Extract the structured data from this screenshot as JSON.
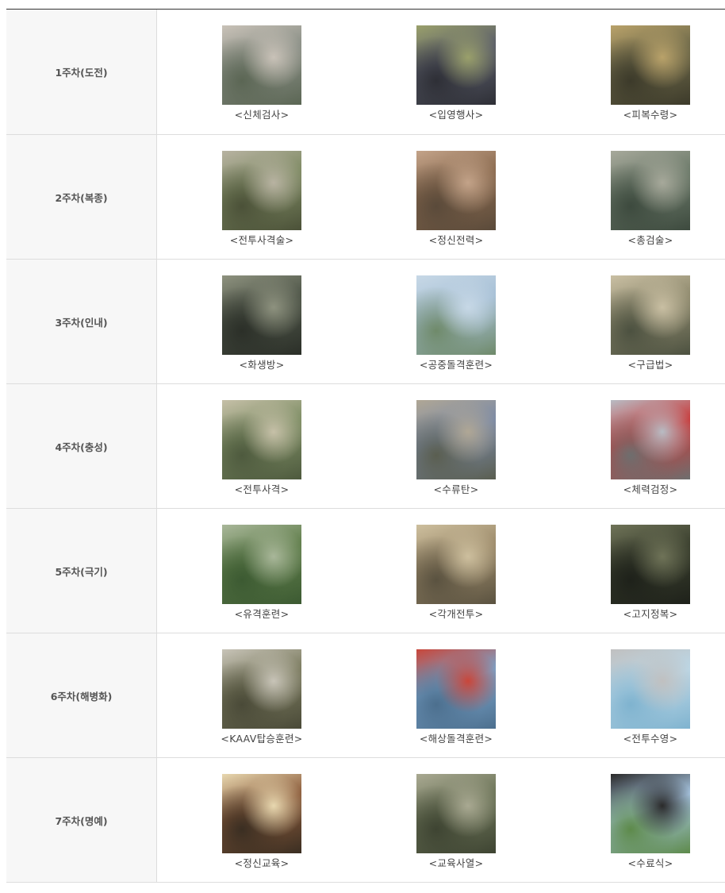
{
  "rows": [
    {
      "week": "1주차(도전)",
      "items": [
        {
          "caption": "<신체검사>",
          "photo": "soldier-medical-check-photo",
          "colors": [
            "#8a8f86",
            "#5b6654",
            "#c9c2b8"
          ]
        },
        {
          "caption": "<입영행사>",
          "photo": "enlistment-crowd-photo",
          "colors": [
            "#5a5d6a",
            "#2e2f36",
            "#9aa06b"
          ]
        },
        {
          "caption": "<피복수령>",
          "photo": "uniform-issue-photo",
          "colors": [
            "#6f6a4a",
            "#3c3a2a",
            "#b9a26a"
          ]
        }
      ]
    },
    {
      "week": "2주차(복종)",
      "items": [
        {
          "caption": "<전투사격술>",
          "photo": "rifle-marksmanship-photo",
          "colors": [
            "#7e8a63",
            "#4b5138",
            "#b8b3a2"
          ]
        },
        {
          "caption": "<정신전력>",
          "photo": "mental-strength-photo",
          "colors": [
            "#8a6a4f",
            "#5a4a3a",
            "#c3a389"
          ]
        },
        {
          "caption": "<총검술>",
          "photo": "bayonet-drill-photo",
          "colors": [
            "#6c7a6a",
            "#3d4a3e",
            "#a7a99b"
          ]
        }
      ]
    },
    {
      "week": "3주차(인내)",
      "items": [
        {
          "caption": "<화생방>",
          "photo": "gas-mask-training-photo",
          "colors": [
            "#4e5548",
            "#2b2f28",
            "#8e927f"
          ]
        },
        {
          "caption": "<공중돌격훈련>",
          "photo": "air-assault-training-photo",
          "colors": [
            "#a7c0d6",
            "#6f8a6a",
            "#c7d8e6"
          ]
        },
        {
          "caption": "<구급법>",
          "photo": "first-aid-training-photo",
          "colors": [
            "#8f8a6e",
            "#4c5140",
            "#c9bfa3"
          ]
        }
      ]
    },
    {
      "week": "4주차(충성)",
      "items": [
        {
          "caption": "<전투사격>",
          "photo": "combat-shooting-photo",
          "colors": [
            "#7d8d64",
            "#4e5a3e",
            "#c6c0a8"
          ]
        },
        {
          "caption": "<수류탄>",
          "photo": "grenade-training-photo",
          "colors": [
            "#7b8aa6",
            "#5a5e50",
            "#b0a795"
          ]
        },
        {
          "caption": "<체력검정>",
          "photo": "fitness-test-photo",
          "colors": [
            "#c83a3a",
            "#6e6e6e",
            "#b8bcc4"
          ]
        }
      ]
    },
    {
      "week": "5주차(극기)",
      "items": [
        {
          "caption": "<유격훈련>",
          "photo": "guerrilla-training-photo",
          "colors": [
            "#5f7d4a",
            "#3c5a32",
            "#a9b79a"
          ]
        },
        {
          "caption": "<각개전투>",
          "photo": "individual-combat-photo",
          "colors": [
            "#9c8a6a",
            "#5a5240",
            "#cdbf9e"
          ]
        },
        {
          "caption": "<고지정복>",
          "photo": "hill-conquest-photo",
          "colors": [
            "#3a3f2e",
            "#1e211a",
            "#6f7358"
          ]
        }
      ]
    },
    {
      "week": "6주차(해병화)",
      "items": [
        {
          "caption": "<KAAV탑승훈련>",
          "photo": "kaav-boarding-photo",
          "colors": [
            "#7a7a5e",
            "#4a4a38",
            "#c8c4b8"
          ]
        },
        {
          "caption": "<해상돌격훈련>",
          "photo": "sea-assault-photo",
          "colors": [
            "#7aa3c9",
            "#4c6f8e",
            "#c9463a"
          ]
        },
        {
          "caption": "<전투수영>",
          "photo": "combat-swimming-photo",
          "colors": [
            "#bcd7e6",
            "#7fb3cf",
            "#c0c0c0"
          ]
        }
      ]
    },
    {
      "week": "7주차(명예)",
      "items": [
        {
          "caption": "<정신교육>",
          "photo": "mental-education-photo",
          "colors": [
            "#8a5a3a",
            "#3a2e22",
            "#e8d8b0"
          ]
        },
        {
          "caption": "<교육사열>",
          "photo": "training-review-photo",
          "colors": [
            "#6c7458",
            "#3e4432",
            "#a9a992"
          ]
        },
        {
          "caption": "<수료식>",
          "photo": "graduation-ceremony-photo",
          "colors": [
            "#a9c7e3",
            "#5d8a4a",
            "#2a2a2a"
          ]
        }
      ]
    }
  ]
}
